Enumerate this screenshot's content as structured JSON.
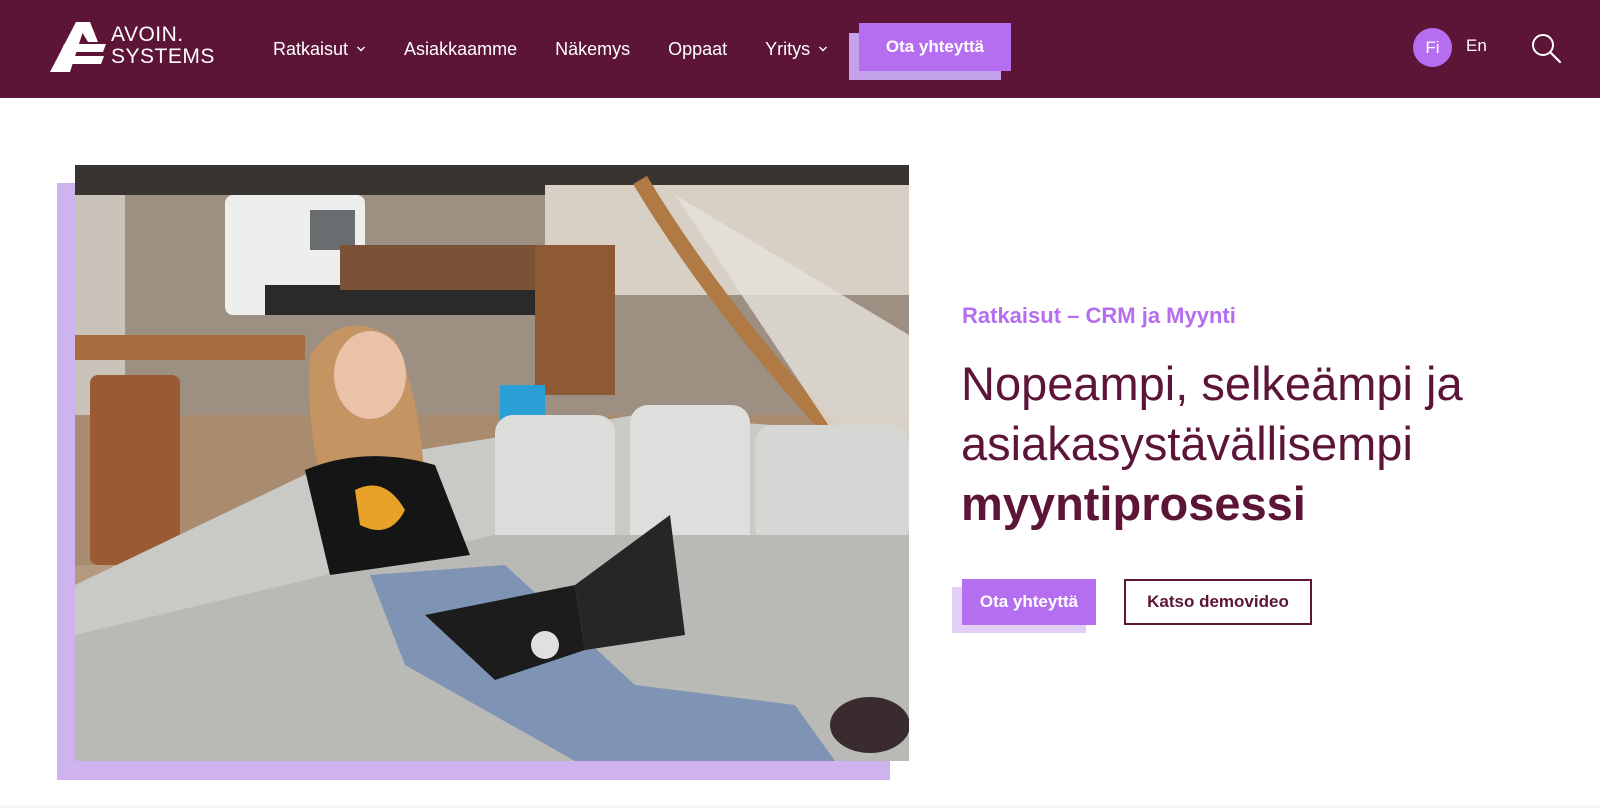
{
  "brand": {
    "line1": "AVOIN.",
    "line2": "SYSTEMS",
    "logo_icon": "avoin-logo-mark"
  },
  "nav": {
    "items": [
      {
        "label": "Ratkaisut",
        "has_dropdown": true
      },
      {
        "label": "Asiakkaamme",
        "has_dropdown": false
      },
      {
        "label": "Näkemys",
        "has_dropdown": false
      },
      {
        "label": "Oppaat",
        "has_dropdown": false
      },
      {
        "label": "Yritys",
        "has_dropdown": true
      }
    ],
    "cta_label": "Ota yhteyttä"
  },
  "language": {
    "active": "Fi",
    "other": "En"
  },
  "search_icon": "search-icon",
  "hero": {
    "eyebrow": "Ratkaisut – CRM ja Myynti",
    "headline_line1": "Nopeampi, selkeämpi ja",
    "headline_line2": "asiakasystävällisempi",
    "headline_bold": "myyntiprosessi",
    "primary_button": "Ota yhteyttä",
    "secondary_button": "Katso demovideo",
    "image_alt": "Woman with a laptop on a sofa in an office"
  },
  "colors": {
    "header_bg": "#5c1437",
    "accent": "#b66ef0",
    "accent_shadow": "#cfb3ee",
    "headline": "#5c1437"
  }
}
